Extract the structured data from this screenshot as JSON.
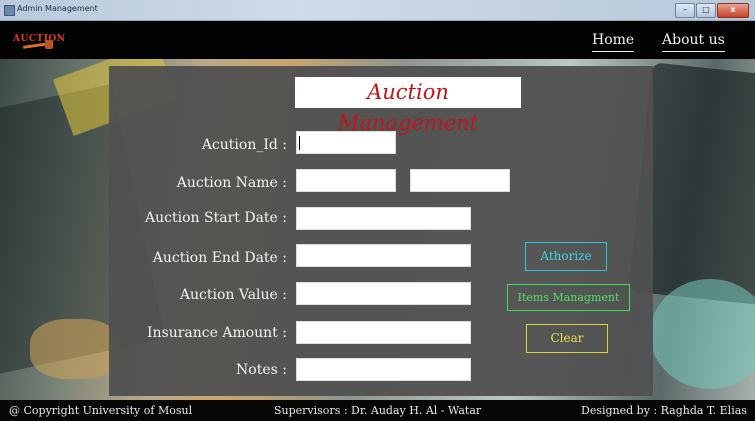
{
  "window": {
    "title": "Admin Management"
  },
  "nav": {
    "logo_text": "AUCTION",
    "home": "Home",
    "about": "About us"
  },
  "form": {
    "title": "Auction Management",
    "fields": {
      "id_label": "Acution_Id :",
      "id_value": "",
      "name_label": "Auction Name :",
      "name_first_value": "",
      "name_second_value": "",
      "start_label": "Auction Start Date :",
      "start_value": "",
      "end_label": "Auction End Date :",
      "end_value": "",
      "value_label": "Auction Value :",
      "value_value": "",
      "insurance_label": "Insurance Amount :",
      "insurance_value": "",
      "notes_label": "Notes :",
      "notes_value": ""
    },
    "buttons": {
      "authorize": "Athorize",
      "items": "Items Managment",
      "clear": "Clear"
    }
  },
  "footer": {
    "copyright": "@ Copyright University of Mosul",
    "supervisors": "Supervisors : Dr. Auday H. Al - Watar",
    "designed": "Designed by : Raghda T. Elias"
  },
  "colors": {
    "title_red": "#c0141c",
    "authorize_cyan": "#2ec4d6",
    "items_green": "#44d95a",
    "clear_yellow": "#d8d63a",
    "logo_red": "#e23a1a"
  },
  "icons": {
    "logo": "auction-gavel-logo",
    "app": "window-app-icon"
  }
}
